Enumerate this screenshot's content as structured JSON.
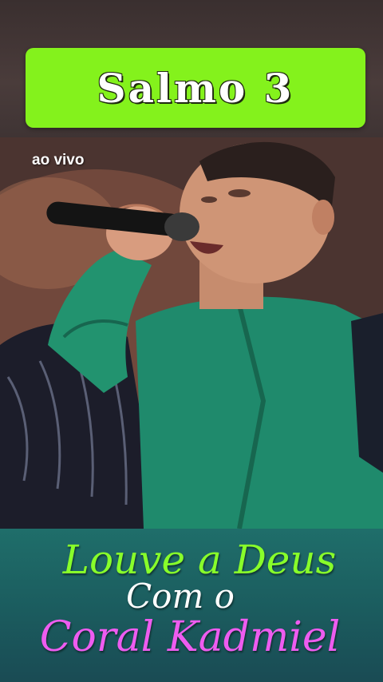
{
  "title": "Salmo 3",
  "live_label": "ao vivo",
  "caption": {
    "line1": "Louve a Deus",
    "line2": "Com o",
    "line3": "Coral Kadmiel"
  },
  "colors": {
    "title_banner": "#84f21c",
    "caption_line1": "#88ff2a",
    "caption_line2": "#ffffff",
    "caption_line3": "#ee5cf0",
    "bottom_band": "#1b5d5f"
  },
  "photo_description_icon": "singer-photo"
}
